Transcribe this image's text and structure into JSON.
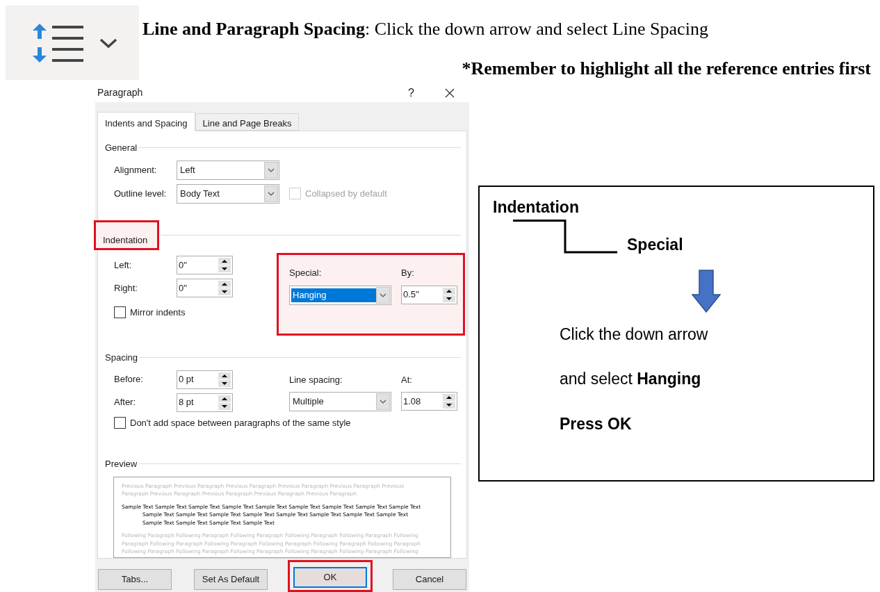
{
  "heading": "**Line and Paragraph Spacing**: Click the down arrow and select Line Spacing",
  "note": "*Remember to highlight all the reference entries first",
  "dialog": {
    "title": "Paragraph",
    "help": "?",
    "tabs": [
      {
        "label": "Indents and Spacing",
        "selected": true
      },
      {
        "label": "Line and Page Breaks",
        "selected": false
      }
    ],
    "general": {
      "heading": "General",
      "alignment": {
        "label": "Alignment:",
        "value": "Left"
      },
      "outline_level": {
        "label": "Outline level:",
        "value": "Body Text"
      },
      "collapsed": {
        "label": "Collapsed by default",
        "checked": false,
        "disabled": true
      }
    },
    "indentation": {
      "heading": "Indentation",
      "annotated": true,
      "left": {
        "label": "Left:",
        "value": "0\""
      },
      "right": {
        "label": "Right:",
        "value": "0\""
      },
      "mirror": {
        "label": "Mirror indents",
        "checked": false
      },
      "annotated_special": true,
      "special": {
        "label": "Special:",
        "value": "Hanging",
        "value_selected": true
      },
      "by": {
        "label": "By:",
        "value": "0.5\""
      }
    },
    "spacing": {
      "heading": "Spacing",
      "before": {
        "label": "Before:",
        "value": "0 pt"
      },
      "after": {
        "label": "After:",
        "value": "8 pt"
      },
      "line_spacing": {
        "label": "Line spacing:",
        "value": "Multiple"
      },
      "at": {
        "label": "At:",
        "value": "1.08"
      },
      "dont_add": {
        "label": "Don't add space between paragraphs of the same style",
        "checked": false
      }
    },
    "preview": {
      "heading": "Preview",
      "previous": [
        "Previous Paragraph Previous Paragraph Previous Paragraph Previous Paragraph Previous Paragraph Previous",
        "Paragraph Previous Paragraph Previous Paragraph Previous Paragraph Previous Paragraph"
      ],
      "sample": [
        "Sample Text Sample Text Sample Text Sample Text Sample Text Sample Text Sample Text Sample Text Sample Text",
        "Sample Text Sample Text Sample Text Sample Text Sample Text Sample Text Sample Text Sample Text",
        "Sample Text Sample Text Sample Text Sample Text"
      ],
      "following": [
        "Following Paragraph Following Paragraph Following Paragraph Following Paragraph Following Paragraph Following",
        "Paragraph Following Paragraph Following Paragraph Following Paragraph Following Paragraph Following Paragraph",
        "Following Paragraph Following Paragraph Following Paragraph Following Paragraph Following Paragraph Following"
      ]
    },
    "buttons": [
      {
        "label": "Tabs...",
        "annotated": false,
        "focused": false
      },
      {
        "label": "Set As Default",
        "annotated": false,
        "focused": false
      },
      {
        "label": "OK",
        "annotated": true,
        "focused": true
      },
      {
        "label": "Cancel",
        "annotated": false,
        "focused": false
      }
    ]
  },
  "callout": {
    "title": "Indentation",
    "subtitle": "Special",
    "lines": [
      {
        "text": "Click the down arrow",
        "bold": false
      },
      {
        "text": "and select **Hanging**",
        "bold": false
      },
      {
        "text": "Press OK",
        "bold": true
      }
    ]
  }
}
